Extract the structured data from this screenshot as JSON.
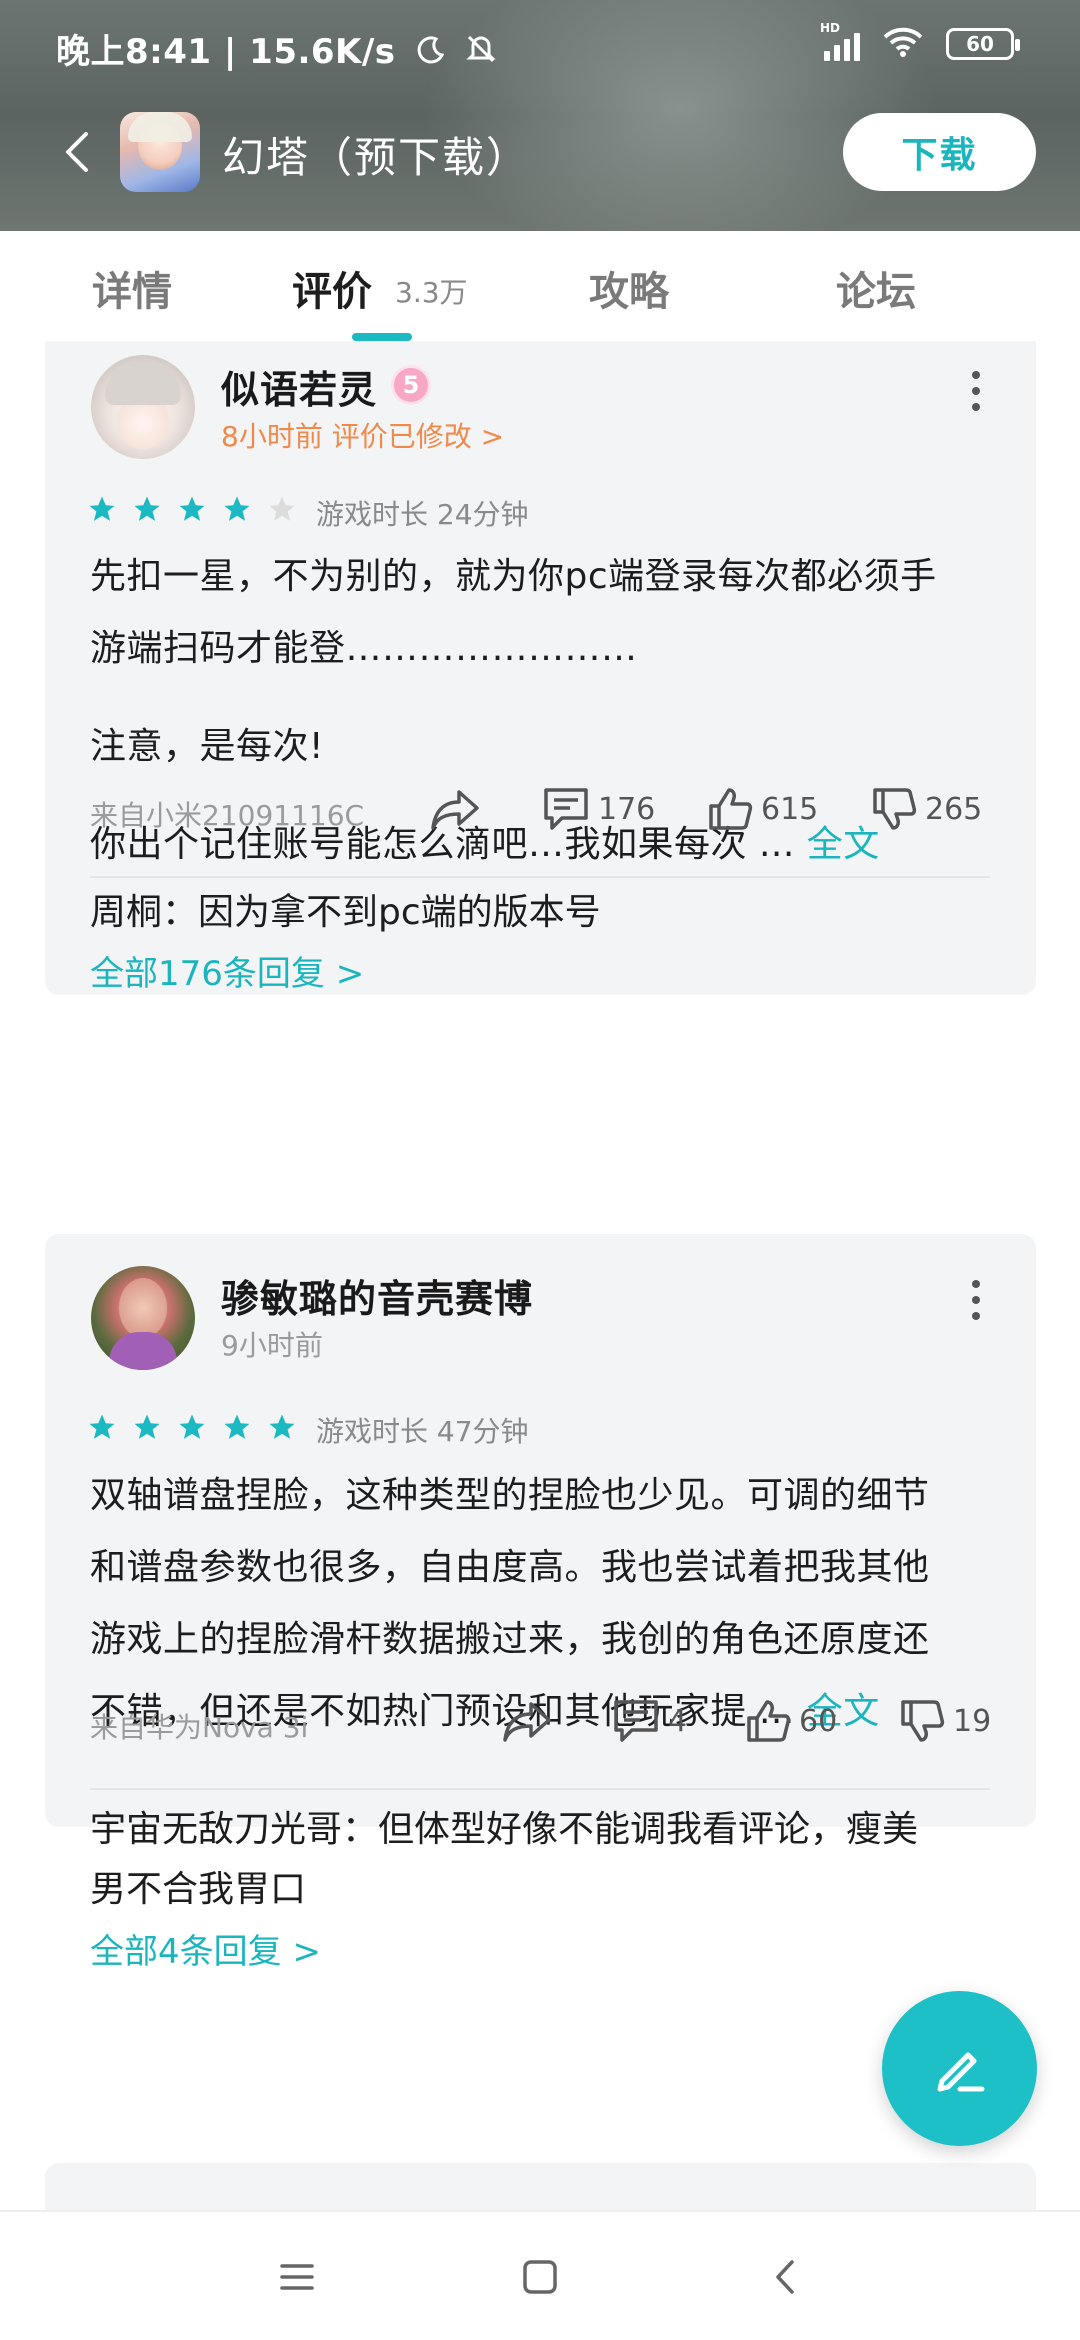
{
  "status_bar": {
    "time_speed": "晚上8:41 | 15.6K/s",
    "battery": "60",
    "network_label": "HD"
  },
  "header": {
    "app_title": "幻塔（预下载）",
    "download_label": "下载"
  },
  "tabs": [
    {
      "label": "详情"
    },
    {
      "label": "评价",
      "count": "3.3万",
      "active": true
    },
    {
      "label": "攻略"
    },
    {
      "label": "论坛"
    }
  ],
  "reviews": [
    {
      "username": "似语若灵",
      "level": "5",
      "time_meta": "8小时前 评价已修改 >",
      "rating": 4,
      "playtime": "游戏时长 24分钟",
      "text_lines": [
        "先扣一星，不为别的，就为你pc端登录每次都必须手",
        "游端扫码才能登……………………",
        "注意，是每次!",
        "你出个记住账号能怎么滴吧…我如果每次 ..."
      ],
      "fulltext_label": "全文",
      "device": "来自小米21091116C",
      "comments": "176",
      "likes": "615",
      "dislikes": "265",
      "reply": "周桐：因为拿不到pc端的版本号",
      "reply_link": "全部176条回复 >"
    },
    {
      "username": "骖敏璐的音壳赛博",
      "time_meta": "9小时前",
      "rating": 5,
      "playtime": "游戏时长 47分钟",
      "text_lines": [
        "双轴谱盘捏脸，这种类型的捏脸也少见。可调的细节",
        "和谱盘参数也很多，自由度高。我也尝试着把我其他",
        "游戏上的捏脸滑杆数据搬过来，我创的角色还原度还",
        "不错，但还是不如热门预设和其他玩家提 ..."
      ],
      "fulltext_label": "全文",
      "device": "来自华为Nova 3i",
      "comments": "4",
      "likes": "60",
      "dislikes": "19",
      "reply_lines": [
        "宇宙无敌刀光哥：但体型好像不能调我看评论，瘦美",
        "男不合我胃口"
      ],
      "reply_link": "全部4条回复 >"
    }
  ],
  "colors": {
    "accent": "#1bb5bd",
    "orange": "#f08a4b",
    "card_bg": "#f3f4f6"
  },
  "icons": [
    "back-icon",
    "signal-icon",
    "wifi-icon",
    "battery-icon",
    "moon-icon",
    "bell-off-icon",
    "star-icon",
    "share-icon",
    "comment-icon",
    "thumb-up-icon",
    "thumb-down-icon",
    "more-icon",
    "edit-icon",
    "menu-icon",
    "home-icon",
    "nav-back-icon"
  ]
}
